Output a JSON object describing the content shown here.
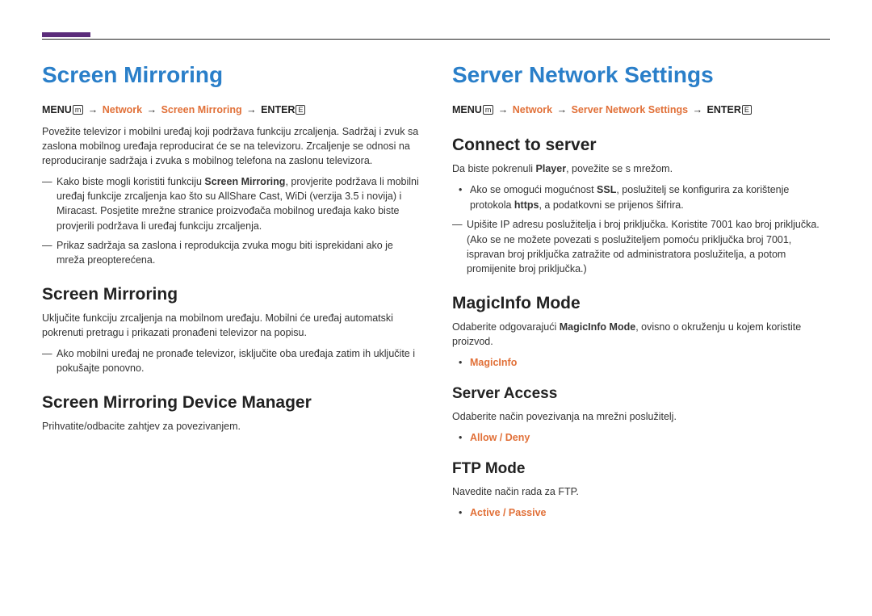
{
  "left": {
    "heading": "Screen Mirroring",
    "path_menu": "MENU",
    "path_menu_icon": "m",
    "path_network": "Network",
    "path_item": "Screen Mirroring",
    "path_enter": "ENTER",
    "path_enter_icon": "E",
    "arrow": "→",
    "intro": "Povežite televizor i mobilni uređaj koji podržava funkciju zrcaljenja. Sadržaj i zvuk sa zaslona mobilnog uređaja reproducirat će se na televizoru. Zrcaljenje se odnosi na reproduciranje sadržaja i zvuka s mobilnog telefona na zaslonu televizora.",
    "note1_a": "Kako biste mogli koristiti funkciju ",
    "note1_bold": "Screen Mirroring",
    "note1_b": ", provjerite podržava li mobilni uređaj funkcije zrcaljenja kao što su AllShare Cast, WiDi (verzija 3.5 i novija) i Miracast. Posjetite mrežne stranice proizvođača mobilnog uređaja kako biste provjerili podržava li uređaj funkciju zrcaljenja.",
    "note2": "Prikaz sadržaja sa zaslona i reprodukcija zvuka mogu biti isprekidani ako je mreža preopterećena.",
    "s1_heading": "Screen Mirroring",
    "s1_body": "Uključite funkciju zrcaljenja na mobilnom uređaju. Mobilni će uređaj automatski pokrenuti pretragu i prikazati pronađeni televizor na popisu.",
    "s1_note": "Ako mobilni uređaj ne pronađe televizor, isključite oba uređaja zatim ih uključite i pokušajte ponovno.",
    "s2_heading": "Screen Mirroring Device Manager",
    "s2_body": "Prihvatite/odbacite zahtjev za povezivanjem."
  },
  "right": {
    "heading": "Server Network Settings",
    "path_menu": "MENU",
    "path_menu_icon": "m",
    "path_network": "Network",
    "path_item": "Server Network Settings",
    "path_enter": "ENTER",
    "path_enter_icon": "E",
    "arrow": "→",
    "s1_heading": "Connect to server",
    "s1_body_a": "Da biste pokrenuli ",
    "s1_body_bold": "Player",
    "s1_body_b": ", povežite se s mrežom.",
    "s1_dot_a": "Ako se omogući mogućnost ",
    "s1_dot_bold1": "SSL",
    "s1_dot_b": ", poslužitelj se konfigurira za korištenje protokola ",
    "s1_dot_bold2": "https",
    "s1_dot_c": ", a podatkovni se prijenos šifrira.",
    "s1_note": "Upišite IP adresu poslužitelja i broj priključka. Koristite 7001 kao broj priključka. (Ako se ne možete povezati s poslužiteljem pomoću priključka broj 7001, ispravan broj priključka zatražite od administratora poslužitelja, a potom promijenite broj priključka.)",
    "s2_heading": "MagicInfo Mode",
    "s2_body_a": "Odaberite odgovarajući ",
    "s2_body_bold": "MagicInfo Mode",
    "s2_body_b": ", ovisno o okruženju u kojem koristite proizvod.",
    "s2_opt": "MagicInfo",
    "s3_heading": "Server Access",
    "s3_body": "Odaberite način povezivanja na mrežni poslužitelj.",
    "s3_opt": "Allow / Deny",
    "s4_heading": "FTP Mode",
    "s4_body": "Navedite način rada za FTP.",
    "s4_opt": "Active / Passive"
  }
}
